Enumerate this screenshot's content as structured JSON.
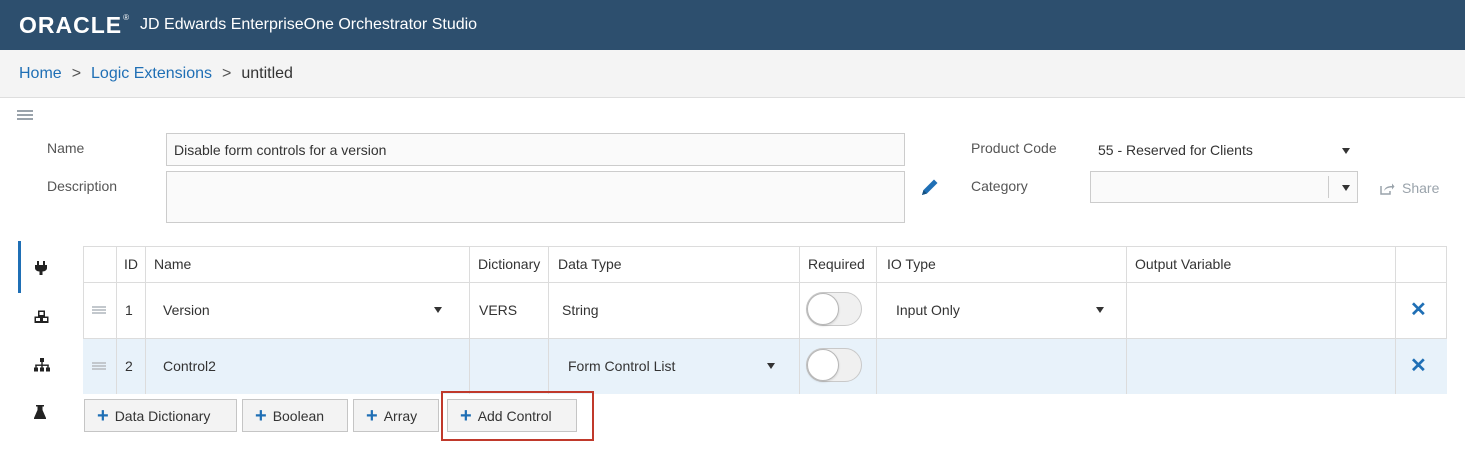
{
  "header": {
    "logo_text": "ORACLE",
    "logo_reg": "®",
    "app_title": "JD Edwards EnterpriseOne Orchestrator Studio",
    "bg_color": "#2d4f6e"
  },
  "breadcrumb": {
    "home": "Home",
    "sep1": ">",
    "logic": "Logic Extensions",
    "sep2": ">",
    "current": "untitled"
  },
  "form": {
    "name_label": "Name",
    "name_value": "Disable form controls for a version",
    "description_label": "Description",
    "description_value": "",
    "product_code_label": "Product Code",
    "product_code_value": "55 - Reserved for Clients",
    "category_label": "Category",
    "category_value": "",
    "share_label": "Share"
  },
  "table": {
    "headers": {
      "id": "ID",
      "name": "Name",
      "dictionary": "Dictionary",
      "data_type": "Data Type",
      "required": "Required",
      "io_type": "IO Type",
      "output_variable": "Output Variable"
    },
    "rows": [
      {
        "id": "1",
        "name": "Version",
        "dictionary": "VERS",
        "data_type": "String",
        "required": false,
        "io_type": "Input Only",
        "output_variable": ""
      },
      {
        "id": "2",
        "name": "Control2",
        "dictionary": "",
        "data_type": "Form Control List",
        "required": false,
        "io_type": "",
        "output_variable": ""
      }
    ]
  },
  "buttons": {
    "data_dictionary": "Data Dictionary",
    "boolean": "Boolean",
    "array": "Array",
    "add_control": "Add Control"
  },
  "sidenav": {
    "icons": [
      "plug-icon",
      "cubes-icon",
      "sitemap-icon",
      "flask-icon"
    ]
  },
  "colors": {
    "accent": "#1f6fb5",
    "highlight": "#c0392b",
    "selected_row": "#e8f2fa"
  }
}
